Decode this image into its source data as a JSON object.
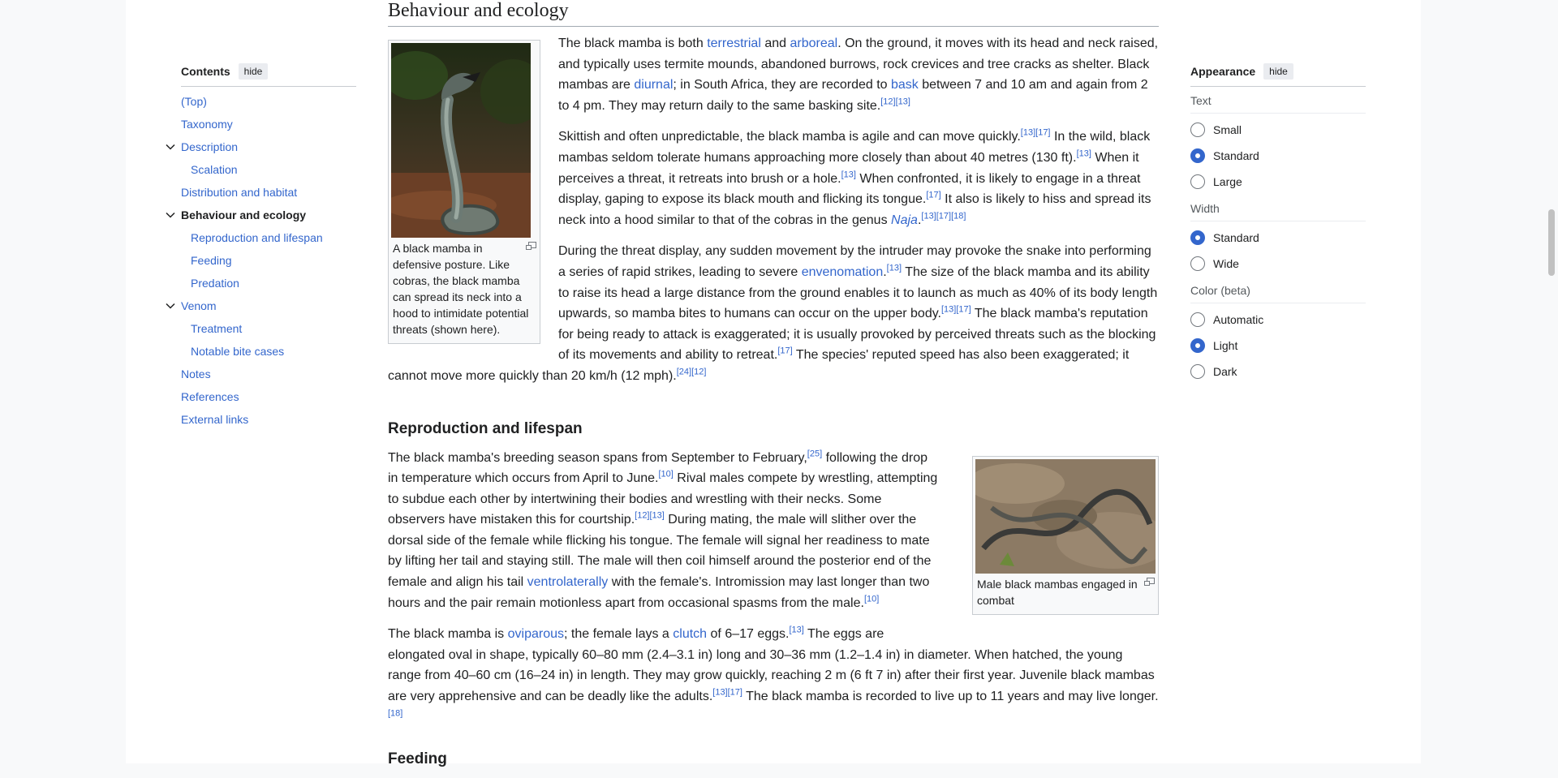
{
  "toc": {
    "title": "Contents",
    "hide_label": "hide",
    "items": [
      {
        "label": "(Top)"
      },
      {
        "label": "Taxonomy"
      },
      {
        "label": "Description"
      },
      {
        "label": "Scalation"
      },
      {
        "label": "Distribution and habitat"
      },
      {
        "label": "Behaviour and ecology"
      },
      {
        "label": "Reproduction and lifespan"
      },
      {
        "label": "Feeding"
      },
      {
        "label": "Predation"
      },
      {
        "label": "Venom"
      },
      {
        "label": "Treatment"
      },
      {
        "label": "Notable bite cases"
      },
      {
        "label": "Notes"
      },
      {
        "label": "References"
      },
      {
        "label": "External links"
      }
    ]
  },
  "article": {
    "section_title": "Behaviour and ecology",
    "figure1_caption": "A black mamba in defensive posture. Like cobras, the black mamba can spread its neck into a hood to intimidate potential threats (shown here).",
    "p1": {
      "t1": "The black mamba is both ",
      "l1": "terrestrial",
      "t2": " and ",
      "l2": "arboreal",
      "t3": ". On the ground, it moves with its head and neck raised, and typically uses termite mounds, abandoned burrows, rock crevices and tree cracks as shelter. Black mambas are ",
      "l3": "diurnal",
      "t4": "; in South Africa, they are recorded to ",
      "l4": "bask",
      "t5": " between 7 and 10 am and again from 2 to 4 pm. They may return daily to the same basking site.",
      "r1": "[12][13]"
    },
    "p2": {
      "t1": "Skittish and often unpredictable, the black mamba is agile and can move quickly.",
      "r1": "[13][17]",
      "t2": " In the wild, black mambas seldom tolerate humans approaching more closely than about 40 metres (130 ft).",
      "r2": "[13]",
      "t3": " When it perceives a threat, it retreats into brush or a hole.",
      "r3": "[13]",
      "t4": " When confronted, it is likely to engage in a threat display, gaping to expose its black mouth and flicking its tongue.",
      "r4": "[17]",
      "t5": " It also is likely to hiss and spread its neck into a hood similar to that of the cobras in the genus ",
      "l1": "Naja",
      "t6": ".",
      "r5": "[13][17][18]"
    },
    "p3": {
      "t1": "During the threat display, any sudden movement by the intruder may provoke the snake into performing a series of rapid strikes, leading to severe ",
      "l1": "envenomation",
      "t2": ".",
      "r1": "[13]",
      "t3": " The size of the black mamba and its ability to raise its head a large distance from the ground enables it to launch as much as 40% of its body length upwards, so mamba bites to humans can occur on the upper body.",
      "r2": "[13][17]",
      "t4": " The black mamba's reputation for being ready to attack is exaggerated; it is usually provoked by perceived threats such as the blocking of its movements and ability to retreat.",
      "r3": "[17]",
      "t5": " The species' reputed speed has also been exaggerated; it cannot move more quickly than 20 km/h (12 mph).",
      "r4": "[24][12]"
    },
    "repro_title": "Reproduction and lifespan",
    "figure2_caption": "Male black mambas engaged in combat",
    "p4": {
      "t1": "The black mamba's breeding season spans from September to February,",
      "r1": "[25]",
      "t2": " following the drop in temperature which occurs from April to June.",
      "r2": "[10]",
      "t3": " Rival males compete by wrestling, attempting to subdue each other by intertwining their bodies and wrestling with their necks. Some observers have mistaken this for courtship.",
      "r3": "[12][13]",
      "t4": " During mating, the male will slither over the dorsal side of the female while flicking his tongue. The female will signal her readiness to mate by lifting her tail and staying still. The male will then coil himself around the posterior end of the female and align his tail ",
      "l1": "ventrolaterally",
      "t5": " with the female's. Intromission may last longer than two hours and the pair remain motionless apart from occasional spasms from the male.",
      "r4": "[10]"
    },
    "p5": {
      "t1": "The black mamba is ",
      "l1": "oviparous",
      "t2": "; the female lays a ",
      "l2": "clutch",
      "t3": " of 6–17 eggs.",
      "r1": "[13]",
      "t4": " The eggs are elongated oval in shape, typically 60–80 mm (2.4–3.1 in) long and 30–36 mm (1.2–1.4 in) in diameter. When hatched, the young range from 40–60 cm (16–24 in) in length. They may grow quickly, reaching 2 m (6 ft 7 in) after their first year. Juvenile black mambas are very apprehensive and can be deadly like the adults.",
      "r2": "[13][17]",
      "t5": " The black mamba is recorded to live up to 11 years and may live longer.",
      "r3": "[18]"
    },
    "feeding_title": "Feeding"
  },
  "appearance": {
    "title": "Appearance",
    "hide_label": "hide",
    "text_label": "Text",
    "text_options": [
      "Small",
      "Standard",
      "Large"
    ],
    "text_selected": "Standard",
    "width_label": "Width",
    "width_options": [
      "Standard",
      "Wide"
    ],
    "width_selected": "Standard",
    "color_label": "Color (beta)",
    "color_options": [
      "Automatic",
      "Light",
      "Dark"
    ],
    "color_selected": "Light"
  },
  "colors": {
    "link": "#3366cc",
    "radio_selected": "#3366cc",
    "text": "#202122",
    "background": "#f8f9fa"
  }
}
